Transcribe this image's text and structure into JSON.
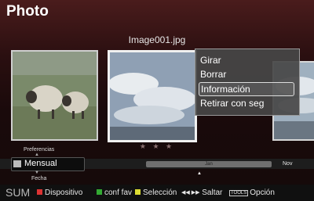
{
  "header": {
    "title": "Photo"
  },
  "viewer": {
    "filename": "Image001.jpg",
    "rating": "★ ★ ★"
  },
  "context_menu": {
    "items": [
      "Girar",
      "Borrar",
      "Información",
      "Retirar con seg"
    ],
    "selected": "Información"
  },
  "sort_panel": {
    "above_label": "Preferencias",
    "current": "Mensual",
    "below_label": "Fecha"
  },
  "timeline": {
    "center_label": "Jan",
    "right_label": "Nov"
  },
  "bottom_bar": {
    "source_label": "SUM",
    "items": [
      "Dispositivo",
      "conf fav",
      "Selección",
      "Saltar",
      "Opción"
    ],
    "tools_label": "TOOLS",
    "skip_symbol": "◀◀ ▶▶"
  }
}
